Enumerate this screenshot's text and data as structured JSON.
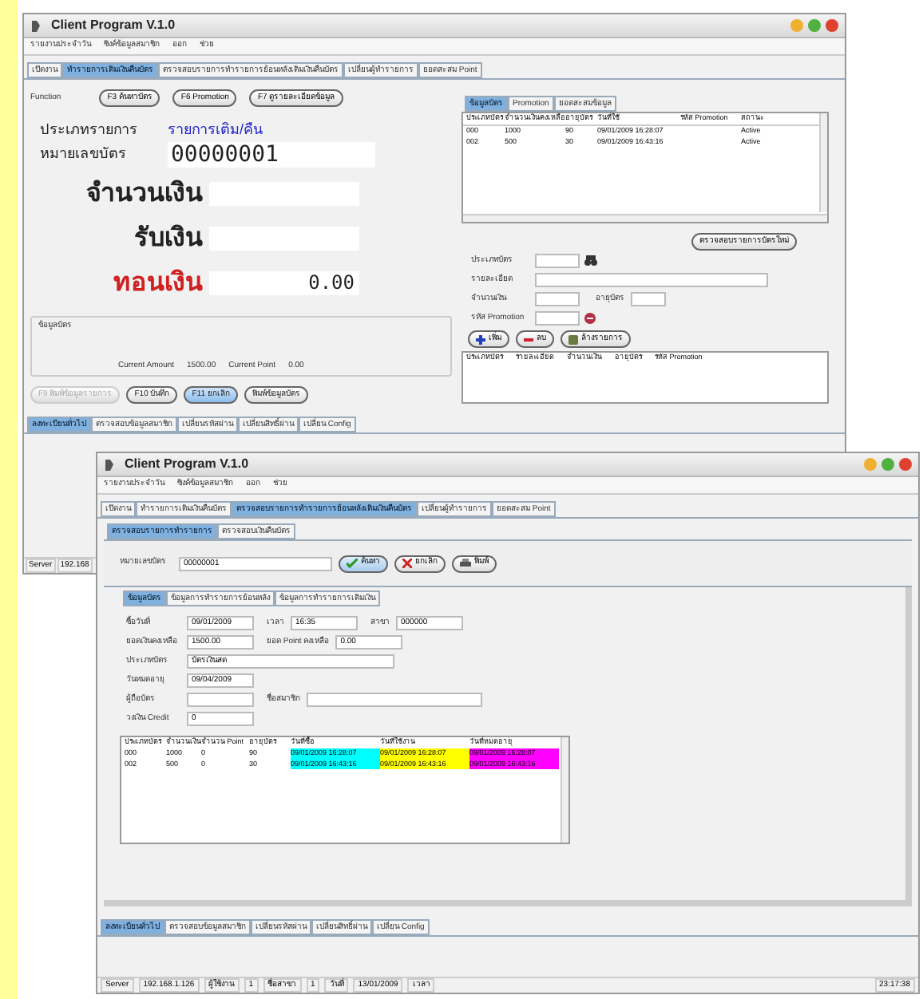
{
  "window_back": {
    "title": "Client Program V.1.0",
    "menu": [
      "รายงานประจำวัน",
      "ซิงค์ข้อมูลสมาชิก",
      "ออก",
      "ช่วย"
    ],
    "tabs": [
      {
        "label": "เปิดงาน",
        "selected": false
      },
      {
        "label": "ทำรายการเติมเงินคืนบัตร",
        "selected": true
      },
      {
        "label": "ตรวจสอบรายการทำรายการย้อนหลังเติมเงินคืนบัตร",
        "selected": false
      },
      {
        "label": "เปลี่ยนผู้ทำรายการ",
        "selected": false
      },
      {
        "label": "ยอดสะสม Point",
        "selected": false
      }
    ],
    "function_label": "Function",
    "function_buttons": [
      "F3 ค้นหาบัตร",
      "F6 Promotion",
      "F7 ดูรายละเอียดข้อมูล"
    ],
    "type_label": "ประเภทรายการ",
    "type_value": "รายการเติม/คืน",
    "card_label": "หมายเลขบัตร",
    "card_value": "00000001",
    "amount_label": "จำนวนเงิน",
    "received_label": "รับเงิน",
    "change_label": "ทอนเงิน",
    "change_value": "0.00",
    "info_group": {
      "title": "ข้อมูลบัตร",
      "amount_label": "Current Amount",
      "amount_value": "1500.00",
      "point_label": "Current Point",
      "point_value": "0.00"
    },
    "buttons": [
      {
        "label": "F9 พิมพ์ข้อมูลรายการ",
        "disabled": true,
        "focused": false
      },
      {
        "label": "F10 บันทึก",
        "disabled": false,
        "focused": false
      },
      {
        "label": "F11 ยกเลิก",
        "disabled": false,
        "focused": true
      },
      {
        "label": "พิมพ์ข้อมูลบัตร",
        "disabled": false,
        "focused": false
      }
    ],
    "side_tabs": [
      {
        "label": "ข้อมูลบัตร",
        "selected": true
      },
      {
        "label": "Promotion",
        "selected": false
      },
      {
        "label": "ยอดสะสมข้อมูล",
        "selected": false
      }
    ],
    "side_table": {
      "columns": [
        "ประเภทบัตร",
        "จำนวนเงินคงเหลือ",
        "อายุบัตร",
        "วันที่ใช้",
        "รหัส Promotion",
        "สถานะ"
      ],
      "rows": [
        [
          "000",
          "1000",
          "90",
          "09/01/2009 16:28:07",
          null,
          "Active"
        ],
        [
          "002",
          "500",
          "30",
          "09/01/2009 16:43:16",
          null,
          "Active"
        ]
      ]
    },
    "check_button": "ตรวจสอบรายการบัตรใหม่",
    "form": {
      "type_label": "ประเภทบัตร",
      "detail_label": "รายละเอียด",
      "amount_label": "จำนวนเงิน",
      "age_label": "อายุบัตร",
      "promo_label": "รหัส Promotion"
    },
    "form_buttons": [
      "เพิ่ม",
      "ลบ",
      "ล้างรายการ"
    ],
    "lower_table": {
      "columns": [
        "ประเภทบัตร",
        "รายละเอียด",
        "จำนวนเงิน",
        "อายุบัตร",
        "รหัส Promotion"
      ]
    },
    "bottom_tabs": [
      {
        "label": "ลงทะเบียนทั่วไป",
        "selected": true
      },
      {
        "label": "ตรวจสอบข้อมูลสมาชิก",
        "selected": false
      },
      {
        "label": "เปลี่ยนรหัสผ่าน",
        "selected": false
      },
      {
        "label": "เปลี่ยนสิทธิ์ผ่าน",
        "selected": false
      },
      {
        "label": "เปลี่ยน Config",
        "selected": false
      }
    ],
    "status": [
      "Server",
      "192.168"
    ]
  },
  "window_front": {
    "title": "Client Program V.1.0",
    "menu": [
      "รายงานประจำวัน",
      "ซิงค์ข้อมูลสมาชิก",
      "ออก",
      "ช่วย"
    ],
    "tabs": [
      {
        "label": "เปิดงาน",
        "selected": false
      },
      {
        "label": "ทำรายการเติมเงินคืนบัตร",
        "selected": false
      },
      {
        "label": "ตรวจสอบรายการทำรายการย้อนหลังเติมเงินคืนบัตร",
        "selected": true
      },
      {
        "label": "เปลี่ยนผู้ทำรายการ",
        "selected": false
      },
      {
        "label": "ยอดสะสม Point",
        "selected": false
      }
    ],
    "sub_tabs": [
      {
        "label": "ตรวจสอบรายการทำรายการ",
        "selected": true
      },
      {
        "label": "ตรวจสอบเงินคืนบัตร",
        "selected": false
      }
    ],
    "card_label": "หมายเลขบัตร",
    "card_value": "00000001",
    "search_buttons": [
      {
        "kind": "ok",
        "label": "ค้นหา"
      },
      {
        "kind": "cancel",
        "label": "ยกเลิก"
      },
      {
        "kind": "print",
        "label": "พิมพ์"
      }
    ],
    "detail_tabs": [
      {
        "label": "ข้อมูลบัตร",
        "selected": true
      },
      {
        "label": "ข้อมูลการทำรายการย้อนหลัง",
        "selected": false
      },
      {
        "label": "ข้อมูลการทำรายการเติมเงิน",
        "selected": false
      }
    ],
    "fields": [
      [
        {
          "label": "ซื้อวันที่",
          "value": "09/01/2009"
        },
        {
          "label": "เวลา",
          "value": "16:35"
        },
        {
          "label": "สาขา",
          "value": "000000"
        }
      ],
      [
        {
          "label": "ยอดเงินคงเหลือ",
          "value": "1500.00"
        },
        {
          "label": "ยอด Point คงเหลือ",
          "value": "0.00"
        }
      ],
      [
        {
          "label": "ประเภทบัตร",
          "value": "บัตรเงินสด"
        }
      ],
      [
        {
          "label": "วันหมดอายุ",
          "value": "09/04/2009"
        }
      ],
      [
        {
          "label": "ผู้ถือบัตร"
        },
        {
          "label": "ชื่อสมาชิก"
        }
      ],
      [
        {
          "label": "วงเงิน Credit",
          "value": "0"
        }
      ]
    ],
    "table": {
      "columns": [
        {
          "label": "ประเภทบัตร"
        },
        {
          "label": "จำนวนเงิน"
        },
        {
          "label": "จำนวน Point"
        },
        {
          "label": "อายุบัตร"
        },
        {
          "label": "วันที่ซื้อ",
          "color": "#00ffff"
        },
        {
          "label": "วันที่ใช้งาน",
          "color": "#ffff00"
        },
        {
          "label": "วันที่หมดอายุ",
          "color": "#ff00ff"
        }
      ],
      "rows": [
        [
          "000",
          "1000",
          "0",
          "90",
          "09/01/2009 16:28:07",
          "09/01/2009 16:28:07",
          "09/01/2009 16:28:07"
        ],
        [
          "002",
          "500",
          "0",
          "30",
          "09/01/2009 16:43:16",
          "09/01/2009 16:43:16",
          "09/01/2009 16:43:16"
        ]
      ]
    },
    "bottom_tabs": [
      {
        "label": "ลงทะเบียนทั่วไป",
        "selected": true
      },
      {
        "label": "ตรวจสอบข้อมูลสมาชิก",
        "selected": false
      },
      {
        "label": "เปลี่ยนรหัสผ่าน",
        "selected": false
      },
      {
        "label": "เปลี่ยนสิทธิ์ผ่าน",
        "selected": false
      },
      {
        "label": "เปลี่ยน Config",
        "selected": false
      }
    ],
    "status": [
      "Server",
      "192.168.1.126",
      "ผู้ใช้งาน",
      "1",
      "ชื่อสาขา",
      "1",
      "วันที่",
      "13/01/2009",
      "เวลา",
      "23:17:38"
    ]
  }
}
